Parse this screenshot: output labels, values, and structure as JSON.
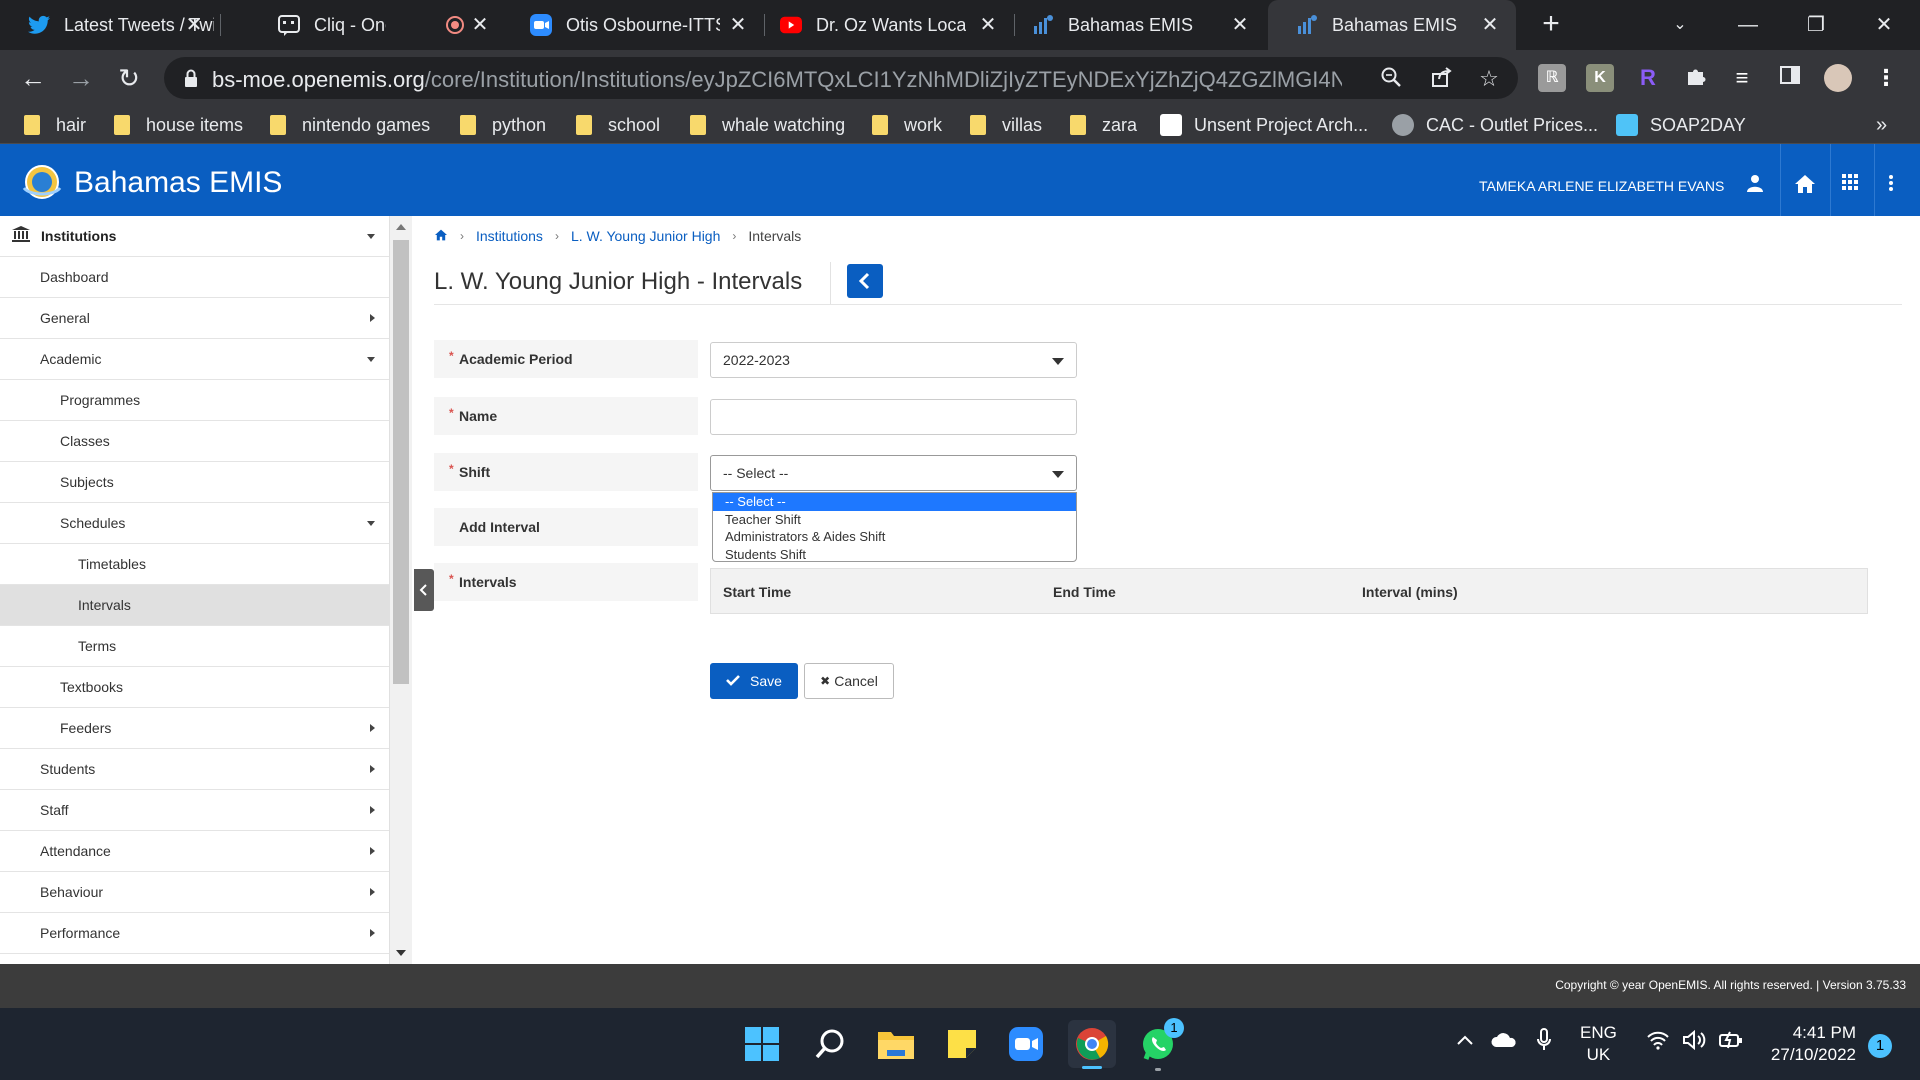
{
  "browser": {
    "tabs": [
      {
        "title": "Latest Tweets / Twitter",
        "icon": "twitter-icon",
        "active": false
      },
      {
        "title": "Cliq - One on One",
        "icon": "cliq-icon",
        "active": false
      },
      {
        "title": "Otis Osbourne-ITTS",
        "icon": "zoom-icon",
        "active": false
      },
      {
        "title": "Dr. Oz Wants Local",
        "icon": "youtube-icon",
        "active": false
      },
      {
        "title": "Bahamas EMIS",
        "icon": "emis-icon",
        "active": false
      },
      {
        "title": "Bahamas EMIS",
        "icon": "emis-icon",
        "active": true
      }
    ],
    "url_host": "bs-moe.openemis.org",
    "url_path": "/core/Institution/Institutions/eyJpZCI6MTQxLCI1YzNhMDliZjIyZTEyNDExYjZhZjQ4ZGZlMGI4NWMyZ...",
    "bookmarks": [
      {
        "label": "hair",
        "type": "folder"
      },
      {
        "label": "house items",
        "type": "folder"
      },
      {
        "label": "nintendo games",
        "type": "folder"
      },
      {
        "label": "python",
        "type": "folder"
      },
      {
        "label": "school",
        "type": "folder"
      },
      {
        "label": "whale watching",
        "type": "folder"
      },
      {
        "label": "work",
        "type": "folder"
      },
      {
        "label": "villas",
        "type": "folder"
      },
      {
        "label": "zara",
        "type": "folder"
      },
      {
        "label": "Unsent Project Arch...",
        "type": "site"
      },
      {
        "label": "CAC - Outlet Prices...",
        "type": "site"
      },
      {
        "label": "SOAP2DAY",
        "type": "site"
      }
    ],
    "bookmarks_more": "»"
  },
  "app": {
    "title": "Bahamas EMIS",
    "user": "TAMEKA ARLENE ELIZABETH EVANS"
  },
  "sidebar": {
    "items": [
      {
        "label": "Institutions",
        "level": 0,
        "arrow": "down",
        "bold": true
      },
      {
        "label": "Dashboard",
        "level": 1,
        "arrow": ""
      },
      {
        "label": "General",
        "level": 1,
        "arrow": "right"
      },
      {
        "label": "Academic",
        "level": 1,
        "arrow": "down"
      },
      {
        "label": "Programmes",
        "level": 2,
        "arrow": ""
      },
      {
        "label": "Classes",
        "level": 2,
        "arrow": ""
      },
      {
        "label": "Subjects",
        "level": 2,
        "arrow": ""
      },
      {
        "label": "Schedules",
        "level": 2,
        "arrow": "down"
      },
      {
        "label": "Timetables",
        "level": 3,
        "arrow": ""
      },
      {
        "label": "Intervals",
        "level": 3,
        "arrow": "",
        "selected": true
      },
      {
        "label": "Terms",
        "level": 3,
        "arrow": ""
      },
      {
        "label": "Textbooks",
        "level": 2,
        "arrow": ""
      },
      {
        "label": "Feeders",
        "level": 2,
        "arrow": "right"
      },
      {
        "label": "Students",
        "level": 1,
        "arrow": "right"
      },
      {
        "label": "Staff",
        "level": 1,
        "arrow": "right"
      },
      {
        "label": "Attendance",
        "level": 1,
        "arrow": "right"
      },
      {
        "label": "Behaviour",
        "level": 1,
        "arrow": "right"
      },
      {
        "label": "Performance",
        "level": 1,
        "arrow": "right"
      }
    ]
  },
  "breadcrumb": {
    "items": [
      "Institutions",
      "L. W. Young Junior High"
    ],
    "current": "Intervals"
  },
  "page": {
    "title": "L. W. Young Junior High - Intervals"
  },
  "form": {
    "academic_period": {
      "label": "Academic Period",
      "value": "2022-2023"
    },
    "name": {
      "label": "Name",
      "value": ""
    },
    "shift": {
      "label": "Shift",
      "value": "-- Select --",
      "options": [
        "-- Select --",
        "Teacher Shift",
        "Administrators & Aides Shift",
        "Students Shift"
      ],
      "highlighted": 0
    },
    "add_interval": {
      "label": "Add Interval"
    },
    "intervals": {
      "label": "Intervals",
      "columns": [
        "Start Time",
        "End Time",
        "Interval (mins)"
      ]
    },
    "save_label": "Save",
    "cancel_label": "Cancel"
  },
  "footer": {
    "copyright": "Copyright © year OpenEMIS. All rights reserved. | Version 3.75.33"
  },
  "taskbar": {
    "lang": "ENG",
    "region": "UK",
    "time": "4:41 PM",
    "date": "27/10/2022",
    "notification_count": "1",
    "whatsapp_badge": "1"
  },
  "colors": {
    "brand_blue": "#0a5ec1",
    "required_red": "#d9534f",
    "dropdown_highlight": "#1e78ff"
  }
}
